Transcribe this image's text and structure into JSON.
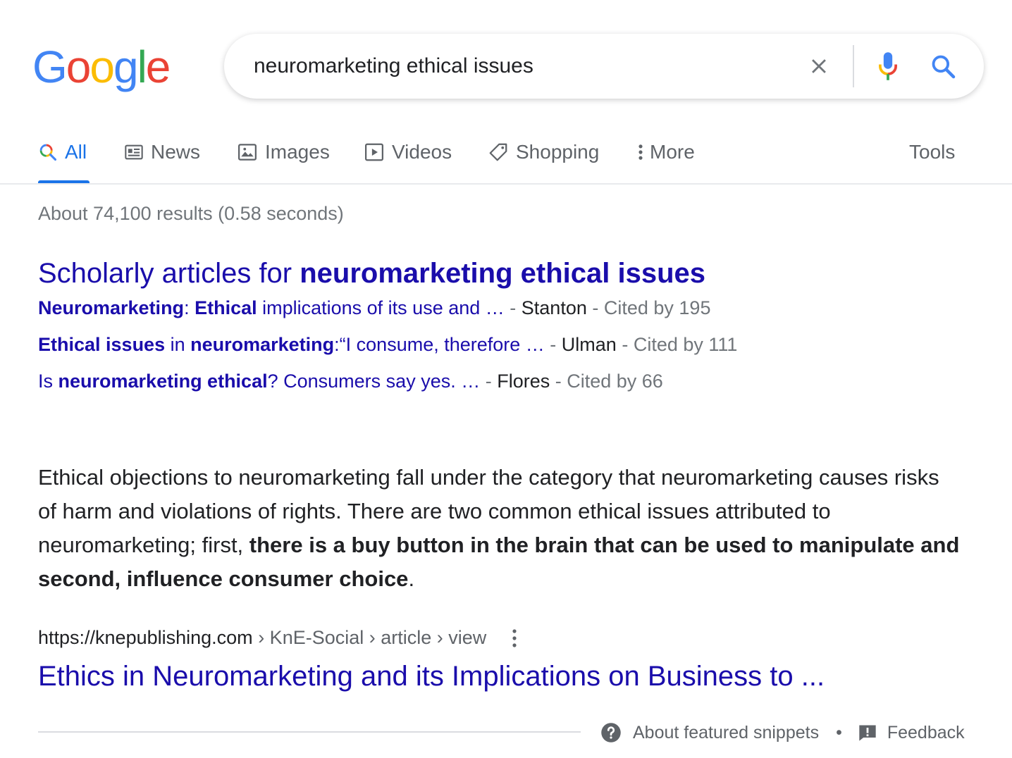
{
  "logo": {
    "letters": [
      "G",
      "o",
      "o",
      "g",
      "l",
      "e"
    ]
  },
  "search": {
    "query": "neuromarketing ethical issues"
  },
  "icons": {
    "clear": "close-icon",
    "mic": "microphone-icon",
    "search": "search-icon",
    "all": "search-icon",
    "news": "news-icon",
    "images": "image-icon",
    "videos": "video-play-icon",
    "shopping": "tag-icon",
    "more": "vertical-dots-icon",
    "help": "question-circle-icon",
    "feedback": "feedback-icon"
  },
  "colors": {
    "brand_blue": "#4285f4",
    "brand_red": "#ea4335",
    "brand_yellow": "#fbbc05",
    "brand_green": "#34a853",
    "link": "#1a0dab",
    "active_tab": "#1a73e8",
    "muted": "#70757a"
  },
  "tabs": {
    "all": "All",
    "news": "News",
    "images": "Images",
    "videos": "Videos",
    "shopping": "Shopping",
    "more": "More",
    "tools": "Tools",
    "active": "All"
  },
  "result_stats": "About 74,100 results (0.58 seconds)",
  "scholarly": {
    "heading_prefix": "Scholarly articles for ",
    "heading_query": "neuromarketing ethical issues",
    "items": [
      {
        "title_parts": [
          "Neuromarketing",
          ": ",
          "Ethical",
          " implications of its use and …"
        ],
        "sep1": " - ",
        "author": "Stanton",
        "sep2": " - ",
        "cited": "Cited by 195"
      },
      {
        "title_parts": [
          "Ethical issues",
          " in ",
          "neuromarketing",
          ":“I consume, therefore …"
        ],
        "sep1": " - ",
        "author": "Ulman",
        "sep2": " - ",
        "cited": "Cited by 111"
      },
      {
        "title_parts": [
          "Is ",
          "neuromarketing ethical",
          "? Consumers say yes. …"
        ],
        "sep1": " - ",
        "author": "Flores",
        "sep2": " - ",
        "cited": "Cited by 66"
      }
    ]
  },
  "snippet": {
    "text_1": "Ethical objections to neuromarketing fall under the category that neuromarketing causes risks of harm and violations of rights. There are two common ethical issues attributed to neuromarketing; first, ",
    "bold": "there is a buy button in the brain that can be used to manipulate and second, influence consumer choice",
    "text_2": "."
  },
  "source": {
    "url": "https://knepublishing.com",
    "breadcrumbs": " › KnE-Social › article › view",
    "title": "Ethics in Neuromarketing and its Implications on Business to ..."
  },
  "footer": {
    "about_snippets": "About featured snippets",
    "bullet": "•",
    "feedback": "Feedback"
  }
}
